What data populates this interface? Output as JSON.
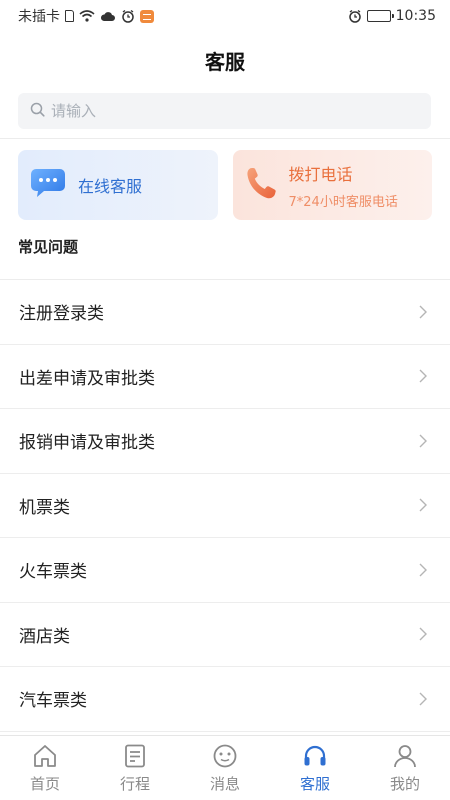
{
  "status_bar": {
    "carrier": "未插卡",
    "time": "10:35",
    "battery_level": 0.8
  },
  "header": {
    "title": "客服"
  },
  "search": {
    "placeholder": "请输入",
    "value": ""
  },
  "cards": {
    "online": {
      "title": "在线客服",
      "icon": "chat-bubble-icon",
      "color": "#2f6fd1"
    },
    "call": {
      "title": "拨打电话",
      "subtitle": "7*24小时客服电话",
      "icon": "phone-icon",
      "color": "#e9703d"
    }
  },
  "faq": {
    "header": "常见问题",
    "items": [
      {
        "label": "注册登录类"
      },
      {
        "label": "出差申请及审批类"
      },
      {
        "label": "报销申请及审批类"
      },
      {
        "label": "机票类"
      },
      {
        "label": "火车票类"
      },
      {
        "label": "酒店类"
      },
      {
        "label": "汽车票类"
      }
    ]
  },
  "tabs": [
    {
      "label": "首页",
      "icon": "home-icon"
    },
    {
      "label": "行程",
      "icon": "itinerary-icon"
    },
    {
      "label": "消息",
      "icon": "message-icon"
    },
    {
      "label": "客服",
      "icon": "headset-icon",
      "active": true
    },
    {
      "label": "我的",
      "icon": "profile-icon"
    }
  ],
  "colors": {
    "accent": "#2f6fd1",
    "call_accent": "#e9703d",
    "inactive": "#8a8a8a"
  }
}
